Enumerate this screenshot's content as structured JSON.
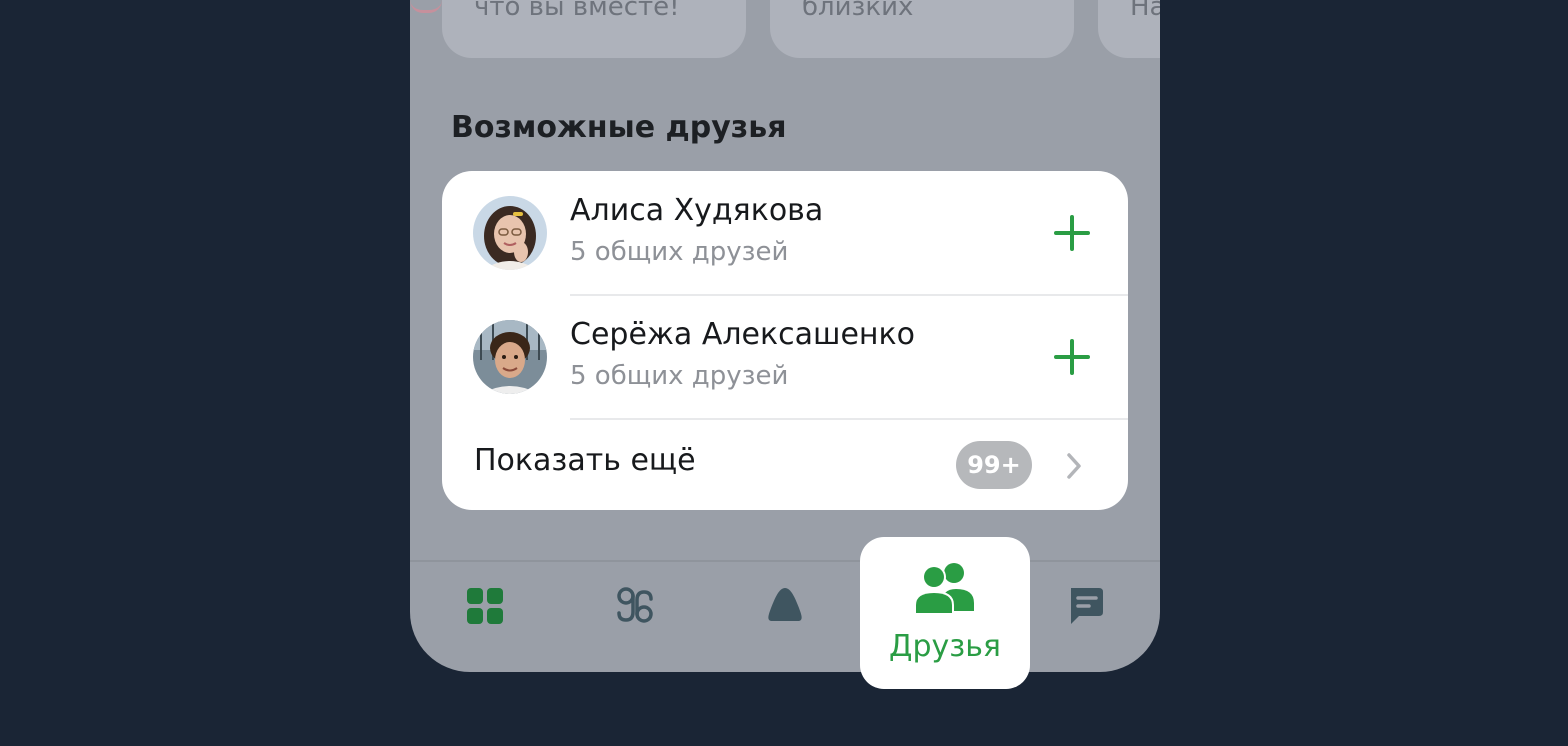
{
  "top_cards": [
    {
      "text": "что вы вместе!"
    },
    {
      "text": "близких"
    },
    {
      "text": "На"
    }
  ],
  "section": {
    "title": "Возможные друзья"
  },
  "friends": [
    {
      "name": "Алиса Худякова",
      "mutual": "5 общих друзей"
    },
    {
      "name": "Серёжа Алексашенко",
      "mutual": "5 общих друзей"
    }
  ],
  "show_more": {
    "label": "Показать ещё",
    "count": "99+"
  },
  "tabbar": {
    "tabs": [
      {
        "icon": "grid-icon"
      },
      {
        "icon": "clips-icon"
      },
      {
        "icon": "bell-icon"
      },
      {
        "icon": "friends-icon",
        "label": "Друзья",
        "active": true
      },
      {
        "icon": "messages-icon"
      }
    ]
  },
  "colors": {
    "accent": "#2a9d44",
    "tab_inactive": "#1f7a3a",
    "overlay_bg": "#9a9fa8",
    "page_bg": "#1a2535"
  }
}
